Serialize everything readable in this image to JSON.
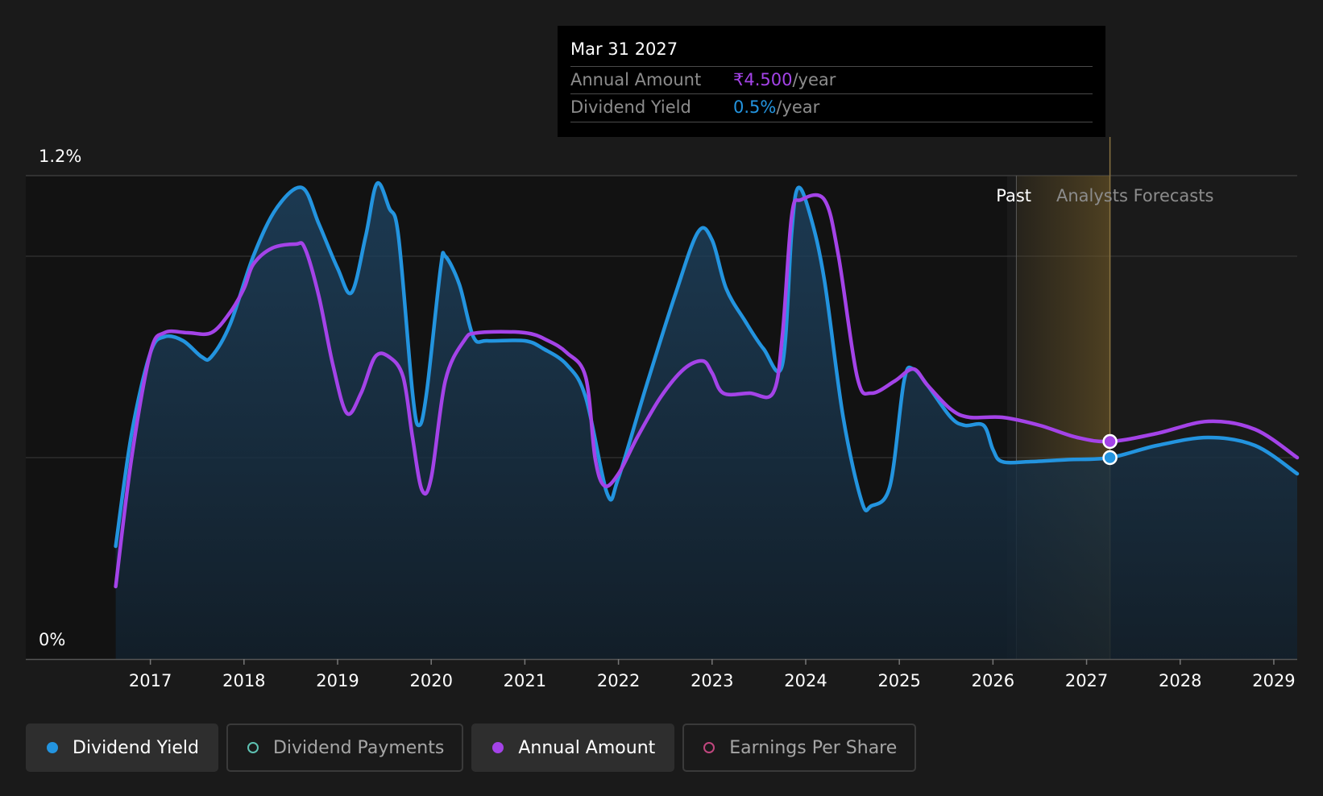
{
  "tooltip": {
    "date": "Mar 31 2027",
    "annual_amount_label": "Annual Amount",
    "annual_amount_value": "₹4.500",
    "annual_amount_unit": "/year",
    "dividend_yield_label": "Dividend Yield",
    "dividend_yield_value": "0.5%",
    "dividend_yield_unit": "/year"
  },
  "regions": {
    "past_label": "Past",
    "forecast_label": "Analysts Forecasts"
  },
  "legend": [
    {
      "label": "Dividend Yield",
      "color": "#2394df",
      "filled": true,
      "active": true
    },
    {
      "label": "Dividend Payments",
      "color": "#5ec1b2",
      "filled": false,
      "active": false
    },
    {
      "label": "Annual Amount",
      "color": "#a443e8",
      "filled": true,
      "active": true
    },
    {
      "label": "Earnings Per Share",
      "color": "#c0467e",
      "filled": false,
      "active": false
    }
  ],
  "chart_data": {
    "type": "area",
    "title": "",
    "y_tick_labels": [
      "0%",
      "1.2%"
    ],
    "ylim": [
      0,
      1.2
    ],
    "xlim": [
      2016.22,
      2029.25
    ],
    "x_ticks": [
      2017,
      2018,
      2019,
      2020,
      2021,
      2022,
      2023,
      2024,
      2025,
      2026,
      2027,
      2028,
      2029
    ],
    "forecast_start": 2026.25,
    "selected_x": 2027.25,
    "grid": true,
    "legend_position": "bottom-left",
    "series": [
      {
        "name": "Dividend Yield",
        "color": "#2394df",
        "points": [
          [
            2016.63,
            0.28
          ],
          [
            2016.8,
            0.56
          ],
          [
            2017.0,
            0.76
          ],
          [
            2017.15,
            0.8
          ],
          [
            2017.35,
            0.79
          ],
          [
            2017.55,
            0.75
          ],
          [
            2017.65,
            0.75
          ],
          [
            2017.85,
            0.83
          ],
          [
            2018.1,
            1.0
          ],
          [
            2018.35,
            1.12
          ],
          [
            2018.62,
            1.17
          ],
          [
            2018.8,
            1.08
          ],
          [
            2019.0,
            0.97
          ],
          [
            2019.15,
            0.91
          ],
          [
            2019.3,
            1.05
          ],
          [
            2019.42,
            1.18
          ],
          [
            2019.55,
            1.12
          ],
          [
            2019.65,
            1.05
          ],
          [
            2019.8,
            0.66
          ],
          [
            2019.87,
            0.58
          ],
          [
            2019.95,
            0.66
          ],
          [
            2020.1,
            0.97
          ],
          [
            2020.15,
            1.0
          ],
          [
            2020.3,
            0.93
          ],
          [
            2020.45,
            0.8
          ],
          [
            2020.6,
            0.79
          ],
          [
            2021.0,
            0.79
          ],
          [
            2021.2,
            0.77
          ],
          [
            2021.45,
            0.73
          ],
          [
            2021.65,
            0.65
          ],
          [
            2021.88,
            0.41
          ],
          [
            2022.0,
            0.45
          ],
          [
            2022.3,
            0.68
          ],
          [
            2022.6,
            0.9
          ],
          [
            2022.85,
            1.06
          ],
          [
            2023.0,
            1.04
          ],
          [
            2023.15,
            0.92
          ],
          [
            2023.35,
            0.84
          ],
          [
            2023.55,
            0.77
          ],
          [
            2023.75,
            0.73
          ],
          [
            2023.85,
            1.06
          ],
          [
            2023.92,
            1.17
          ],
          [
            2024.05,
            1.1
          ],
          [
            2024.2,
            0.94
          ],
          [
            2024.4,
            0.6
          ],
          [
            2024.6,
            0.39
          ],
          [
            2024.7,
            0.38
          ],
          [
            2024.9,
            0.43
          ],
          [
            2025.05,
            0.69
          ],
          [
            2025.15,
            0.72
          ],
          [
            2025.3,
            0.68
          ],
          [
            2025.55,
            0.6
          ],
          [
            2025.7,
            0.58
          ],
          [
            2025.9,
            0.58
          ],
          [
            2026.0,
            0.52
          ],
          [
            2026.1,
            0.49
          ],
          [
            2026.4,
            0.49
          ],
          [
            2026.8,
            0.495
          ],
          [
            2027.25,
            0.5
          ],
          [
            2027.75,
            0.53
          ],
          [
            2028.3,
            0.55
          ],
          [
            2028.8,
            0.53
          ],
          [
            2029.25,
            0.46
          ]
        ]
      },
      {
        "name": "Annual Amount",
        "color": "#a443e8",
        "points": [
          [
            2016.63,
            0.18
          ],
          [
            2016.8,
            0.5
          ],
          [
            2017.0,
            0.76
          ],
          [
            2017.15,
            0.81
          ],
          [
            2017.4,
            0.81
          ],
          [
            2017.65,
            0.81
          ],
          [
            2017.85,
            0.86
          ],
          [
            2018.0,
            0.92
          ],
          [
            2018.1,
            0.98
          ],
          [
            2018.3,
            1.02
          ],
          [
            2018.55,
            1.03
          ],
          [
            2018.65,
            1.02
          ],
          [
            2018.8,
            0.9
          ],
          [
            2018.95,
            0.73
          ],
          [
            2019.1,
            0.61
          ],
          [
            2019.25,
            0.66
          ],
          [
            2019.4,
            0.75
          ],
          [
            2019.55,
            0.75
          ],
          [
            2019.7,
            0.7
          ],
          [
            2019.8,
            0.55
          ],
          [
            2019.9,
            0.42
          ],
          [
            2020.0,
            0.45
          ],
          [
            2020.15,
            0.69
          ],
          [
            2020.35,
            0.79
          ],
          [
            2020.5,
            0.81
          ],
          [
            2021.0,
            0.81
          ],
          [
            2021.25,
            0.79
          ],
          [
            2021.45,
            0.76
          ],
          [
            2021.65,
            0.7
          ],
          [
            2021.75,
            0.5
          ],
          [
            2021.85,
            0.43
          ],
          [
            2022.0,
            0.46
          ],
          [
            2022.2,
            0.55
          ],
          [
            2022.45,
            0.65
          ],
          [
            2022.7,
            0.72
          ],
          [
            2022.9,
            0.74
          ],
          [
            2023.0,
            0.71
          ],
          [
            2023.12,
            0.66
          ],
          [
            2023.4,
            0.66
          ],
          [
            2023.65,
            0.66
          ],
          [
            2023.75,
            0.8
          ],
          [
            2023.85,
            1.1
          ],
          [
            2023.95,
            1.14
          ],
          [
            2024.2,
            1.14
          ],
          [
            2024.35,
            1.0
          ],
          [
            2024.55,
            0.7
          ],
          [
            2024.7,
            0.66
          ],
          [
            2024.95,
            0.69
          ],
          [
            2025.15,
            0.72
          ],
          [
            2025.3,
            0.68
          ],
          [
            2025.55,
            0.62
          ],
          [
            2025.75,
            0.6
          ],
          [
            2026.1,
            0.6
          ],
          [
            2026.5,
            0.58
          ],
          [
            2026.9,
            0.55
          ],
          [
            2027.25,
            0.54
          ],
          [
            2027.75,
            0.56
          ],
          [
            2028.3,
            0.59
          ],
          [
            2028.8,
            0.57
          ],
          [
            2029.25,
            0.5
          ]
        ]
      }
    ]
  }
}
